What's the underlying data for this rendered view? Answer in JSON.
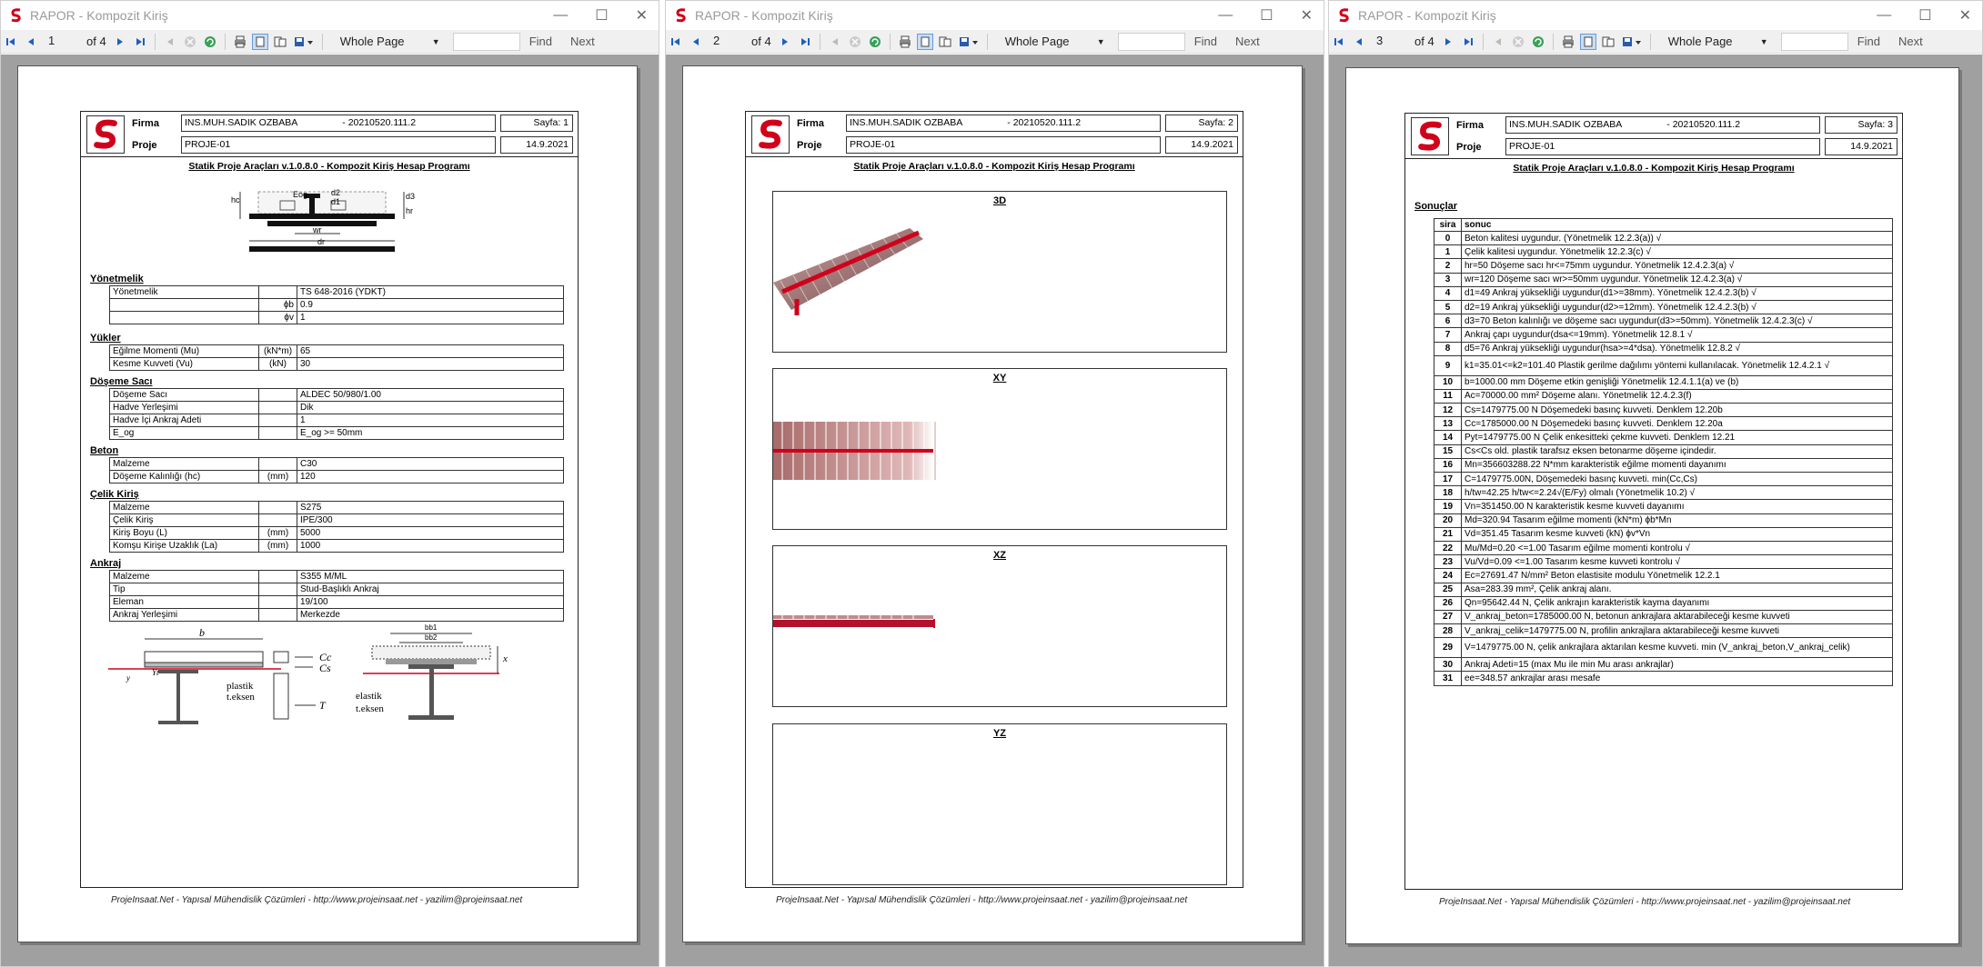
{
  "window_title": "RAPOR - Kompozit Kiriş",
  "controls": {
    "minimize": "—",
    "maximize": "☐",
    "close": "✕"
  },
  "toolbar": {
    "of_prefix": "of",
    "total_pages": "4",
    "zoom": "Whole Page",
    "find": "Find",
    "next": "Next"
  },
  "pages_nav": [
    "1",
    "2",
    "3"
  ],
  "report": {
    "firma_label": "Firma",
    "proje_label": "Proje",
    "firma": "INS.MUH.SADIK OZBABA                 - 20210520.111.2",
    "proje": "PROJE-01",
    "date": "14.9.2021",
    "sayfa": [
      "Sayfa: 1",
      "Sayfa: 2",
      "Sayfa: 3"
    ],
    "title": "Statik Proje Araçları v.1.0.8.0 - Kompozit Kiriş Hesap Programı",
    "footer": "ProjeInsaat.Net - Yapısal Mühendislik Çözümleri - http://www.projeinsaat.net - yazilim@projeinsaat.net"
  },
  "page1": {
    "sections": {
      "yonetmelik": {
        "title": "Yönetmelik",
        "rows": [
          [
            "Yönetmelik",
            "",
            "TS 648-2016 (YDKT)"
          ],
          [
            "",
            "ϕb",
            "0.9"
          ],
          [
            "",
            "ϕv",
            "1"
          ]
        ]
      },
      "yukler": {
        "title": "Yükler",
        "rows": [
          [
            "Eğilme Momenti (Mu)",
            "(kN*m)",
            "65"
          ],
          [
            "Kesme Kuvveti (Vu)",
            "(kN)",
            "30"
          ]
        ]
      },
      "doseme": {
        "title": "Döşeme Sacı",
        "rows": [
          [
            "Döşeme Sacı",
            "",
            "ALDEC 50/980/1.00"
          ],
          [
            "Hadve Yerleşimi",
            "",
            "Dik"
          ],
          [
            "Hadve İçi Ankraj Adeti",
            "",
            "1"
          ],
          [
            "E_og",
            "",
            "E_og >= 50mm"
          ]
        ]
      },
      "beton": {
        "title": "Beton",
        "rows": [
          [
            "Malzeme",
            "",
            "C30"
          ],
          [
            "Döşeme Kalınlığı (hc)",
            "(mm)",
            "120"
          ]
        ]
      },
      "celik": {
        "title": "Çelik Kiriş",
        "rows": [
          [
            "Malzeme",
            "",
            "S275"
          ],
          [
            "Çelik Kiriş",
            "",
            "IPE/300"
          ],
          [
            "Kiriş Boyu (L)",
            "(mm)",
            "5000"
          ],
          [
            "Komşu Kirişe Uzaklık (La)",
            "(mm)",
            "1000"
          ]
        ]
      },
      "ankraj": {
        "title": "Ankraj",
        "rows": [
          [
            "Malzeme",
            "",
            "S355 M/ML"
          ],
          [
            "Tip",
            "",
            "Stud-Başlıklı Ankraj"
          ],
          [
            "Eleman",
            "",
            "19/100"
          ],
          [
            "Ankraj Yerleşimi",
            "",
            "Merkezde"
          ]
        ]
      }
    },
    "diagram_labels": {
      "hc": "hc",
      "eog": "Eog",
      "d2": "d2",
      "d1": "d1",
      "d3": "d3",
      "hr": "hr",
      "wr": "wr",
      "dr": "dr",
      "b": "b",
      "cc": "Cc",
      "cs": "Cs",
      "t": "T",
      "plastik": "plastik",
      "teksen1": "t.eksen",
      "elastik": "elastik",
      "teksen2": "t.eksen",
      "bb1": "bb1",
      "bb2": "bb2",
      "x": "x",
      "yt": "Yt",
      "y": "y"
    }
  },
  "page2": {
    "views": [
      "3D",
      "XY",
      "XZ",
      "YZ"
    ]
  },
  "page3": {
    "section": "Sonuçlar",
    "headers": [
      "sira",
      "sonuc"
    ],
    "rows": [
      [
        "0",
        "Beton kalitesi uygundur. (Yönetmelik 12.2.3(a)) √"
      ],
      [
        "1",
        "Çelik kalitesi uygundur. Yönetmelik 12.2.3(c) √"
      ],
      [
        "2",
        "hr=50 Döşeme sacı hr<=75mm uygundur. Yönetmelik 12.4.2.3(a) √"
      ],
      [
        "3",
        "wr=120 Döşeme sacı wr>=50mm uygundur. Yönetmelik 12.4.2.3(a) √"
      ],
      [
        "4",
        "d1=49 Ankraj yüksekliği uygundur(d1>=38mm). Yönetmelik 12.4.2.3(b) √"
      ],
      [
        "5",
        "d2=19 Ankraj yüksekliği uygundur(d2>=12mm). Yönetmelik 12.4.2.3(b) √"
      ],
      [
        "6",
        "d3=70 Beton kalınlığı ve döşeme sacı uygundur(d3>=50mm). Yönetmelik 12.4.2.3(c) √"
      ],
      [
        "7",
        "Ankraj çapı uygundur(dsa<=19mm). Yönetmelik 12.8.1 √"
      ],
      [
        "8",
        "d5=76 Ankraj yüksekliği uygundur(hsa>=4*dsa). Yönetmelik 12.8.2 √"
      ],
      [
        "9",
        "k1=35.01<=k2=101.40 Plastik gerilme dağılımı yöntemi kullanılacak. Yönetmelik 12.4.2.1 √"
      ],
      [
        "10",
        "b=1000.00 mm Döşeme etkin genişliği Yönetmelik 12.4.1.1(a) ve (b)"
      ],
      [
        "11",
        "Ac=70000.00 mm² Döşeme alanı. Yönetmelik 12.4.2.3(f)"
      ],
      [
        "12",
        "Cs=1479775.00 N Döşemedeki basınç kuvveti. Denklem 12.20b"
      ],
      [
        "13",
        "Cc=1785000.00 N Döşemedeki basınç kuvveti. Denklem 12.20a"
      ],
      [
        "14",
        "Pyt=1479775.00 N Çelik enkesitteki çekme kuvveti. Denklem 12.21"
      ],
      [
        "15",
        "Cs<Cs old. plastik tarafsız eksen betonarme döşeme içindedir."
      ],
      [
        "16",
        "Mn=356603288.22 N*mm karakteristik eğilme momenti dayanımı"
      ],
      [
        "17",
        "C=1479775.00N, Döşemedeki basınç kuvveti. min(Cc,Cs)"
      ],
      [
        "18",
        "h/tw=42.25 h/tw<=2.24√(E/Fy) olmalı (Yönetmelik 10.2) √"
      ],
      [
        "19",
        "Vn=351450.00 N karakteristik kesme kuvveti dayanımı"
      ],
      [
        "20",
        "Md=320.94 Tasarım eğilme momenti (kN*m) ϕb*Mn"
      ],
      [
        "21",
        "Vd=351.45 Tasarım kesme kuvveti (kN) ϕv*Vn"
      ],
      [
        "22",
        "Mu/Md=0.20 <=1.00 Tasarım eğilme momenti kontrolu √"
      ],
      [
        "23",
        "Vu/Vd=0.09 <=1.00 Tasarım kesme kuvveti kontrolu √"
      ],
      [
        "24",
        "Ec=27691.47 N/mm² Beton elastisite modulu Yönetmelik 12.2.1"
      ],
      [
        "25",
        "Asa=283.39 mm², Çelik ankraj alanı."
      ],
      [
        "26",
        "Qn=95642.44 N, Çelik ankrajın karakteristik kayma dayanımı"
      ],
      [
        "27",
        "V_ankraj_beton=1785000.00 N, betonun ankrajlara aktarabileceği kesme kuvveti"
      ],
      [
        "28",
        "V_ankraj_celik=1479775.00 N, profilin ankrajlara aktarabileceği kesme kuvveti"
      ],
      [
        "29",
        "V=1479775.00 N, çelik ankrajlara aktarılan kesme kuvveti. min (V_ankraj_beton,V_ankraj_celik)"
      ],
      [
        "30",
        "Ankraj Adeti=15 (max Mu ile min Mu arası ankrajlar)"
      ],
      [
        "31",
        "ee=348.57 ankrajlar arası mesafe"
      ]
    ]
  }
}
